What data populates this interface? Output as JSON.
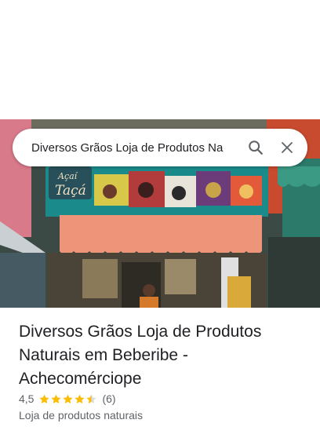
{
  "search": {
    "query": "Diversos Grãos Loja de Produtos Na"
  },
  "photo": {
    "sign_text_1": "Açaí",
    "sign_text_2": "Taçá"
  },
  "place": {
    "title": "Diversos Grãos Loja de Produtos Naturais em Beberibe - Achecomérciope",
    "rating": "4,5",
    "rating_value": 4.5,
    "rating_max": 5,
    "reviews": "(6)",
    "category": "Loja de produtos naturais"
  },
  "colors": {
    "star": "#fbbc04",
    "star_empty": "#dadce0",
    "text_primary": "#202124",
    "text_secondary": "#5f6368"
  },
  "icons": [
    "search-icon",
    "close-icon",
    "star-icon"
  ]
}
